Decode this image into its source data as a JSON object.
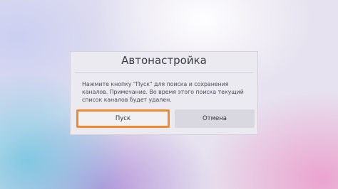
{
  "dialog": {
    "title": "Автонастройка",
    "message": "Нажмите кнопку \"Пуск\" для поиска и сохранения каналов. Примечание. Во время этого поиска текущий список каналов будет удален.",
    "buttons": {
      "start": "Пуск",
      "cancel": "Отмена"
    },
    "focus_color": "#f08a2e"
  }
}
